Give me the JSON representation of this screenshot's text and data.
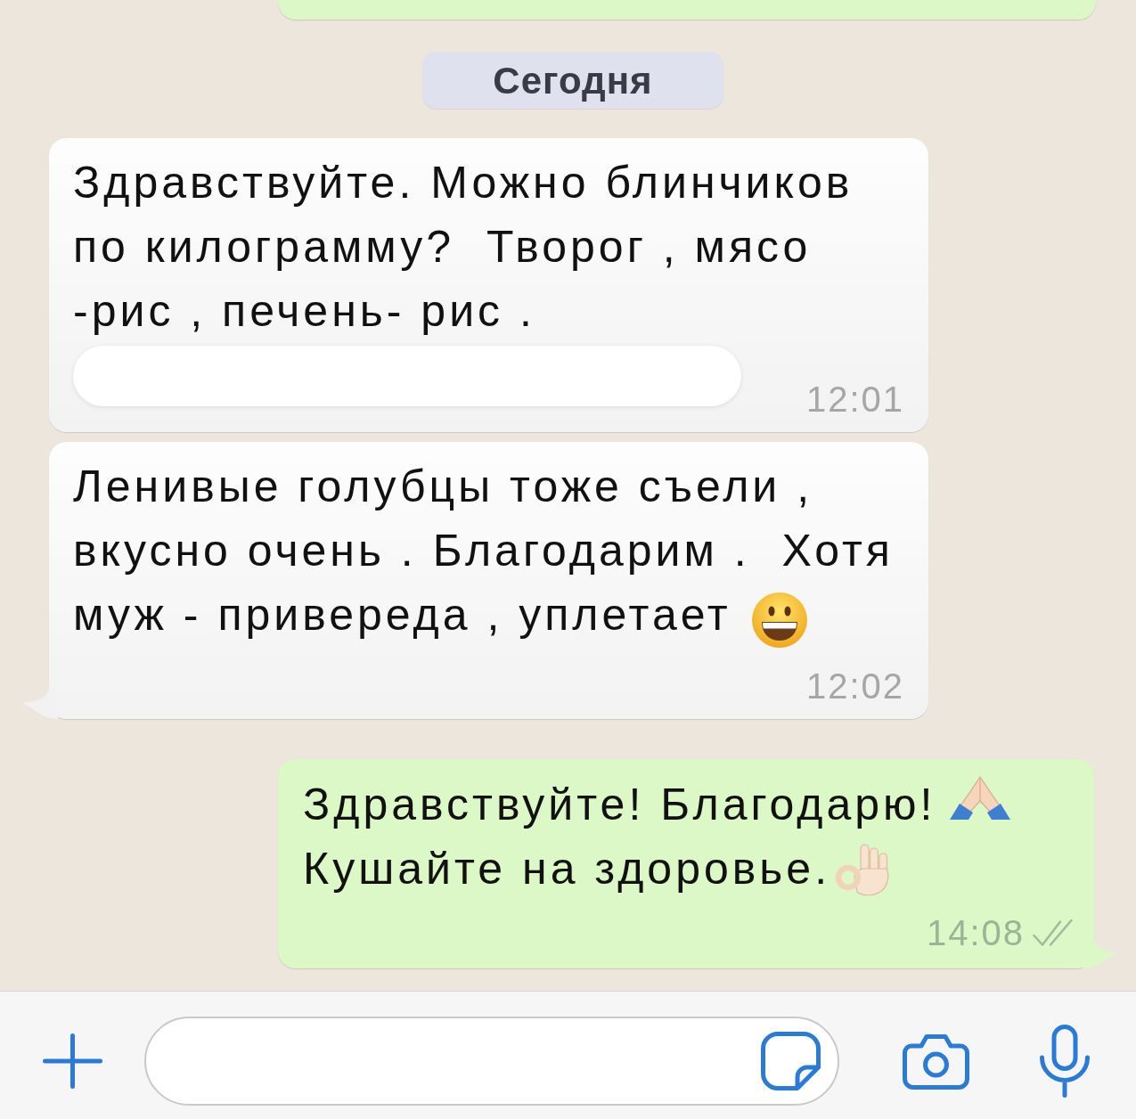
{
  "date_divider": {
    "label": "Сегодня"
  },
  "messages": [
    {
      "kind": "incoming",
      "parts": [
        {
          "kind": "text",
          "text": "Здравствуйте. Можно блинчиков\nпо килограмму?  Творог , мясо\n-рис , печень- рис ."
        }
      ],
      "redacted": true,
      "time": "12:01",
      "tail": false
    },
    {
      "kind": "incoming",
      "parts": [
        {
          "kind": "text",
          "text": "Ленивые голубцы тоже съели ,\nвкусно очень . Благодарим .  Хотя"
        },
        {
          "kind": "text",
          "text": "муж - привереда , уплетает"
        },
        {
          "kind": "grinning"
        }
      ],
      "redacted": false,
      "time": "12:02",
      "tail": true
    },
    {
      "kind": "outgoing",
      "parts": [
        {
          "kind": "text",
          "text": "Здравствуйте! Благодарю!"
        },
        {
          "kind": "praying"
        },
        {
          "kind": "text",
          "text": "Кушайте на здоровье."
        },
        {
          "kind": "ok_hand"
        }
      ],
      "redacted": false,
      "time": "14:08",
      "tail": true,
      "delivered": true,
      "read": false
    }
  ]
}
